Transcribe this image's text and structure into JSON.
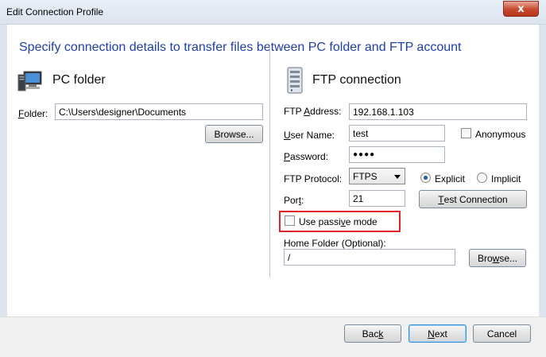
{
  "window": {
    "title": "Edit Connection Profile",
    "close_glyph": "x"
  },
  "heading": "Specify connection details to transfer files between PC folder and FTP account",
  "pc_folder": {
    "section_title": "PC folder",
    "icon": "monitor-icon",
    "folder_label_first": "F",
    "folder_label_rest": "older:",
    "folder_value": "C:\\Users\\designer\\Documents",
    "browse_pre": "Browse",
    "browse_post": "..."
  },
  "ftp": {
    "section_title": "FTP connection",
    "icon": "server-icon",
    "address_label_pre": "FTP ",
    "address_label_u": "A",
    "address_label_post": "ddress:",
    "address_value": "192.168.1.103",
    "username_label_u": "U",
    "username_label_post": "ser Name:",
    "username_value": "test",
    "anonymous_label": "Anonymous",
    "anonymous_checked": false,
    "password_label_u": "P",
    "password_label_post": "assword:",
    "password_value": "●●●●",
    "protocol_label": "FTP Protocol:",
    "protocol_value": "FTPS",
    "explicit_label": "Explicit",
    "implicit_label": "Implicit",
    "explicit_selected": true,
    "port_label_pre": "Por",
    "port_label_u": "t",
    "port_label_post": ":",
    "port_value": "21",
    "test_connection_u": "T",
    "test_connection_post": "est Connection",
    "passive_label_pre": "Use passi",
    "passive_label_u": "v",
    "passive_label_post": "e mode",
    "passive_checked": false,
    "home_folder_label": "Home Folder (Optional):",
    "home_folder_value": "/",
    "browse_pre": "Bro",
    "browse_u": "w",
    "browse_post": "se..."
  },
  "footer": {
    "back_pre": "Bac",
    "back_u": "k",
    "next_u": "N",
    "next_post": "ext",
    "cancel_label": "Cancel"
  },
  "colors": {
    "heading": "#1f3fa7",
    "highlight": "#e0242a"
  }
}
